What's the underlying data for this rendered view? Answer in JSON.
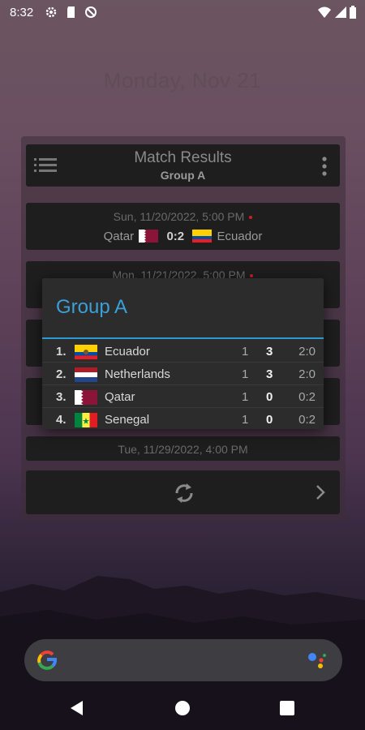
{
  "status": {
    "time": "8:32"
  },
  "date_label": "Monday, Nov 21",
  "widget": {
    "title": "Match Results",
    "subtitle": "Group A",
    "matches": [
      {
        "datetime": "Sun, 11/20/2022, 5:00 PM",
        "home": "Qatar",
        "score": "0:2",
        "away": "Ecuador"
      },
      {
        "datetime": "Mon, 11/21/2022, 5:00 PM"
      },
      {
        "datetime": "Tue, 11/29/2022, 4:00 PM"
      }
    ]
  },
  "dialog": {
    "title": "Group A",
    "rows": [
      {
        "rank": "1.",
        "team": "Ecuador",
        "played": "1",
        "points": "3",
        "goals": "2:0",
        "flag": "ecuador-flag"
      },
      {
        "rank": "2.",
        "team": "Netherlands",
        "played": "1",
        "points": "3",
        "goals": "2:0",
        "flag": "netherlands-flag"
      },
      {
        "rank": "3.",
        "team": "Qatar",
        "played": "1",
        "points": "0",
        "goals": "0:2",
        "flag": "qatar-flag"
      },
      {
        "rank": "4.",
        "team": "Senegal",
        "played": "1",
        "points": "0",
        "goals": "0:2",
        "flag": "senegal-flag"
      }
    ]
  },
  "colors": {
    "accent": "#3aa0d8",
    "card_bg": "#1e1e1f",
    "dialog_bg": "#2c2c2d",
    "live_dot": "#c8202a"
  }
}
